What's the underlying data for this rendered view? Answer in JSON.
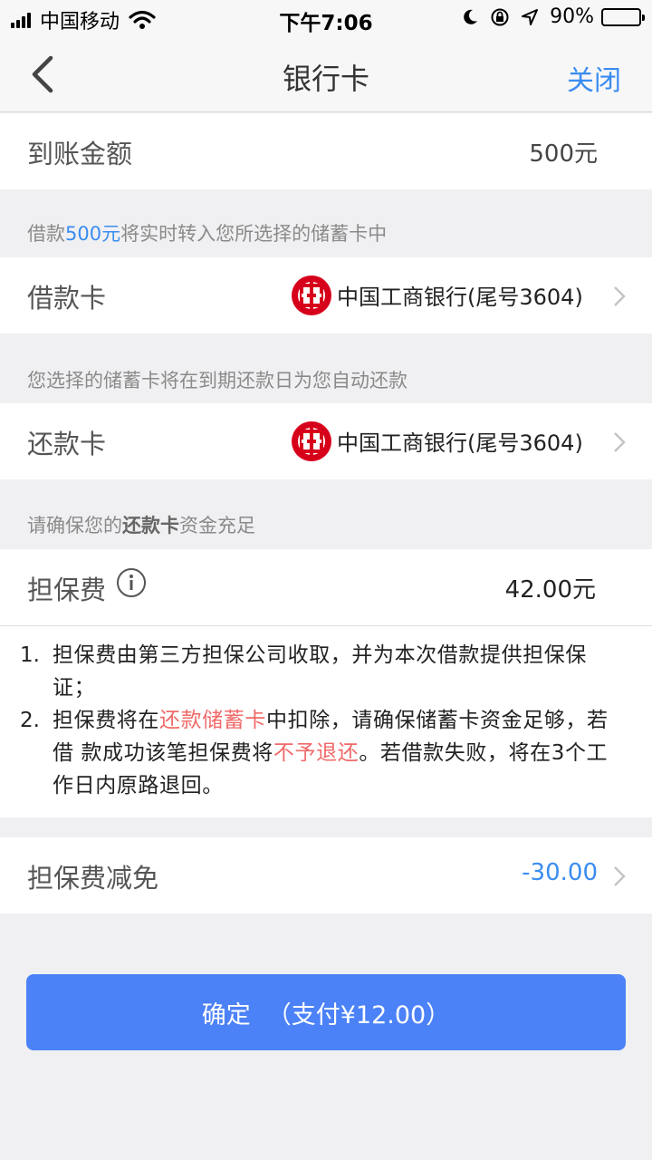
{
  "status": {
    "carrier": "中国移动",
    "time": "下午7:06",
    "battery": "90%",
    "battery_level": 0.9
  },
  "nav": {
    "back_icon": "chevron-left-icon",
    "title": "银行卡",
    "close_label": "关闭"
  },
  "amount_row": {
    "label": "到账金额",
    "value": "500元"
  },
  "hint1": {
    "prefix": "借款",
    "amount": "500元",
    "suffix": "将实时转入您所选择的储蓄卡中"
  },
  "loan_card": {
    "label": "借款卡",
    "bank": "中国工商银行(尾号3604)",
    "logo": "icbc-logo"
  },
  "hint2": {
    "text": "您选择的储蓄卡将在到期还款日为您自动还款"
  },
  "repay_card": {
    "label": "还款卡",
    "bank": "中国工商银行(尾号3604)",
    "logo": "icbc-logo"
  },
  "hint3": {
    "prefix": "请确保您的",
    "bold": "还款卡",
    "suffix": "资金充足"
  },
  "fee_row": {
    "label": "担保费",
    "value": "42.00元",
    "info_icon": "info-icon"
  },
  "notes": [
    {
      "num": "1.",
      "line1": "担保费由第三方担保公司收取，并为本次借款提供担保保",
      "line2": "证；"
    },
    {
      "num": "2.",
      "a": "担保费将在",
      "a_red": "还款储蓄卡",
      "b": "中扣除，请确保储蓄卡资金足够，若",
      "c": "借 款成功该笔担保费将",
      "c_red": "不予退还",
      "d": "。若借款失败，将在3个工",
      "e": "作日内原路退回。"
    }
  ],
  "discount_row": {
    "label": "担保费减免",
    "value": "-30.00"
  },
  "confirm": {
    "label": "确定",
    "pay": "（支付¥12.00）"
  },
  "colors": {
    "accent": "#3a8df0",
    "button": "#4c82f7",
    "red": "#f06a6a",
    "icbc_red": "#d7001b"
  }
}
